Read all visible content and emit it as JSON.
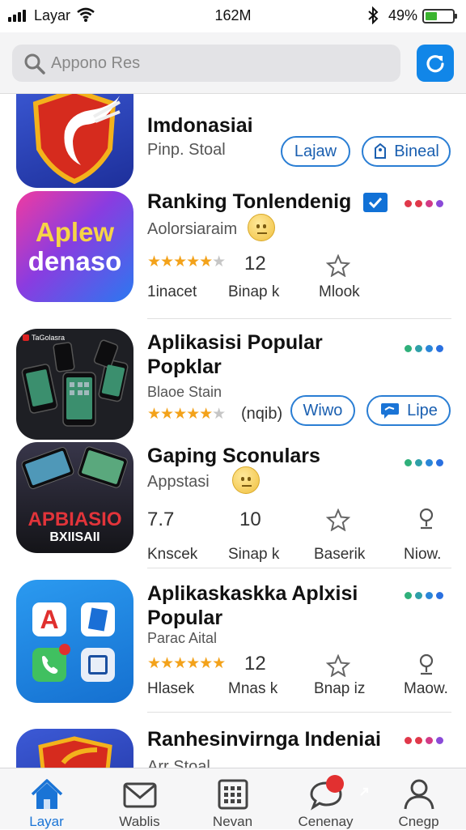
{
  "status_bar": {
    "carrier": "Layar",
    "time": "162M",
    "battery_pct": "49%",
    "battery_level": 0.49,
    "battery_color": "#3bb42f"
  },
  "search": {
    "placeholder": "Appono Res",
    "refresh_icon": "refresh-icon",
    "accent": "#1186e8"
  },
  "apps": [
    {
      "name": "Imdonasiai",
      "subtitle": "Pinp. Stoal",
      "buttons": [
        "Lajaw",
        "Bineal"
      ]
    },
    {
      "name": "Ranking Tonlendenig",
      "subtitle": "Aolorsiaraim",
      "icon_text": [
        "Aplew",
        "denaso"
      ],
      "rating_value": "12",
      "stats": [
        "1inacet",
        "Binap k",
        "Mlook"
      ]
    },
    {
      "name": "Aplikasisi Popular Popklar",
      "subtitle": "Blaoe Stain",
      "rating_note": "(nqib)",
      "icon_badge": "TaGolasra",
      "buttons": [
        "Wiwo",
        "Lipe"
      ]
    },
    {
      "name": "Gaping Sconulars",
      "subtitle": "Appstasi",
      "icon_text": [
        "APBIASIO",
        "BXIISAII"
      ],
      "values": [
        "7.7",
        "10"
      ],
      "stats": [
        "Knscek",
        "Sinap k",
        "Baserik",
        "Niow."
      ]
    },
    {
      "name": "Aplikaskaskka Aplxisi Popular",
      "subtitle": "Parac Aital",
      "icon_letter": "A",
      "rating_value": "12",
      "stats": [
        "Hlasek",
        "Mnas k",
        "Bnap iz",
        "Maow."
      ]
    },
    {
      "name": "Ranhesinvirnga Indeniai",
      "subtitle": "Arr Stoal"
    }
  ],
  "tabs": [
    {
      "label": "Layar",
      "icon": "home-icon",
      "active": true
    },
    {
      "label": "Wablis",
      "icon": "mail-icon"
    },
    {
      "label": "Nevan",
      "icon": "calendar-icon"
    },
    {
      "label": "Cenenay",
      "icon": "chat-icon"
    },
    {
      "label": "Cnegp",
      "icon": "person-icon"
    }
  ]
}
